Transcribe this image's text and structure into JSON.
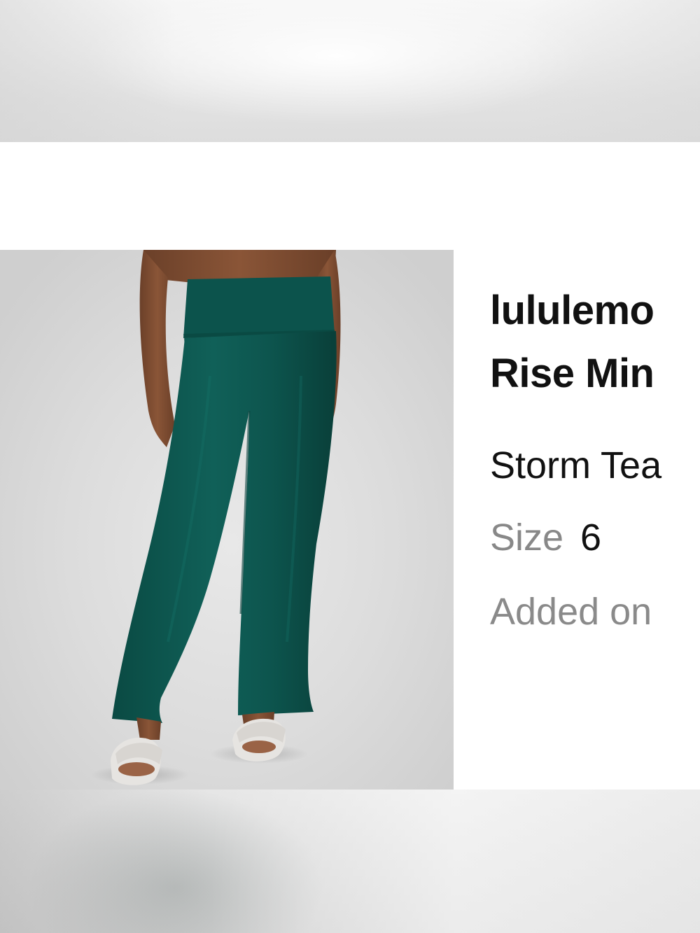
{
  "product": {
    "title_line1": "lululemo",
    "title_line2": "Rise Min",
    "color": "Storm Tea",
    "size_label": "Size",
    "size_value": "6",
    "added_label": "Added on"
  },
  "colors": {
    "pants": "#0f5a52",
    "text_primary": "#111111",
    "text_secondary": "#888888",
    "photo_background": "#d9d9d9"
  },
  "icons": []
}
